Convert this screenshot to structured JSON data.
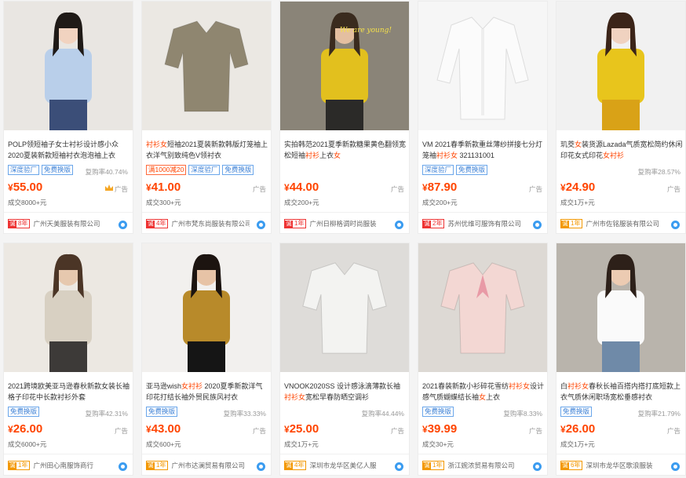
{
  "products": [
    {
      "title": "POLP领短袖子女士衬衫设计感小众2020夏装新款短袖衬衣泡泡袖上衣",
      "title_parts": [
        {
          "t": "POLP领短袖子女士衬衫设计感小众2020夏装新款短袖衬衣泡泡袖上衣",
          "hl": false
        }
      ],
      "tags": [
        {
          "text": "深度验厂",
          "style": "blue"
        },
        {
          "text": "免费换版",
          "style": "blue"
        }
      ],
      "repurchase": "复购率40.74%",
      "price_symbol": "¥",
      "price": "55.00",
      "has_crown": true,
      "ad": "广告",
      "deal": "成交8000+元",
      "years": "8年",
      "badge_color": "red",
      "shop": "广州天美服装有限公司",
      "photo": {
        "bg": "#e9e6e2",
        "top": "#b9cfea",
        "bottom": "#3b4e78",
        "hair": "#1f1a17",
        "skin": "#f1d3c0"
      }
    },
    {
      "title": "衬衫女短袖2021夏装新款韩版灯笼袖上衣洋气别致纯色V领衬衣",
      "title_parts": [
        {
          "t": "衬衫女",
          "hl": true
        },
        {
          "t": "短袖2021夏装新款韩版灯笼袖上衣洋气别致纯色V领衬衣",
          "hl": false
        }
      ],
      "tags": [
        {
          "text": "满1000减20",
          "style": "red"
        },
        {
          "text": "深度验厂",
          "style": "blue"
        },
        {
          "text": "免费换版",
          "style": "blue"
        }
      ],
      "repurchase": "",
      "price_symbol": "¥",
      "price": "41.00",
      "has_crown": false,
      "ad": "广告",
      "deal": "成交300+元",
      "years": "4年",
      "badge_color": "red",
      "shop": "广州市梵东尚服装有限公司",
      "photo": {
        "bg": "#ebe8e3",
        "top": "#8f8670",
        "bottom": "#6c6757",
        "hair": "#d9d5cd",
        "skin": "#ebe8e3"
      }
    },
    {
      "title": "实拍韩范2021夏季新款糖果黄色翻领宽松短袖衬衫上衣女",
      "title_parts": [
        {
          "t": "实拍韩范2021夏季新款糖果黄色翻领宽松短袖",
          "hl": false
        },
        {
          "t": "衬衫",
          "hl": true
        },
        {
          "t": "上衣",
          "hl": false
        },
        {
          "t": "女",
          "hl": true
        }
      ],
      "tags": [],
      "repurchase": "",
      "price_symbol": "¥",
      "price": "44.00",
      "has_crown": false,
      "ad": "广告",
      "deal": "成交200+元",
      "years": "1年",
      "badge_color": "red",
      "shop": "广州日柳格调时尚服装",
      "overlay": "We are young!",
      "photo": {
        "bg": "#8a8478",
        "top": "#e2c01e",
        "bottom": "#2b2a28",
        "hair": "#3a2b1e",
        "skin": "#e4bfa0"
      }
    },
    {
      "title": "VM 2021春季新款重丝薄纱拼接七分灯笼袖衬衫女 321131001",
      "title_parts": [
        {
          "t": "VM 2021春季新款重丝薄纱拼接七分灯笼袖",
          "hl": false
        },
        {
          "t": "衬衫女",
          "hl": true
        },
        {
          "t": " 321131001",
          "hl": false
        }
      ],
      "tags": [
        {
          "text": "深度验厂",
          "style": "blue"
        },
        {
          "text": "免费换版",
          "style": "blue"
        }
      ],
      "repurchase": "",
      "price_symbol": "¥",
      "price": "87.90",
      "has_crown": false,
      "ad": "广告",
      "deal": "成交200+元",
      "years": "2年",
      "badge_color": "red",
      "shop": "苏州优维可服饰有限公司",
      "photo": {
        "bg": "#f6f6f6",
        "top": "#fbfbfb",
        "bottom": "#f6f6f6",
        "hair": "#111111",
        "skin": "#f6f6f6"
      }
    },
    {
      "title": "玑茭女装货源Lazada气质宽松简约休闲印花女式印花女衬衫",
      "title_parts": [
        {
          "t": "玑茭",
          "hl": false
        },
        {
          "t": "女",
          "hl": true
        },
        {
          "t": "装货源Lazada气质宽松简约休闲印花女式印花",
          "hl": false
        },
        {
          "t": "女衬衫",
          "hl": true
        }
      ],
      "tags": [],
      "repurchase": "复购率28.57%",
      "price_symbol": "¥",
      "price": "24.90",
      "has_crown": false,
      "ad": "广告",
      "deal": "成交1万+元",
      "years": "1年",
      "badge_color": "orange",
      "shop": "广州市佐铭服装有限公司",
      "photo": {
        "bg": "#f1f1f1",
        "top": "#e8c51c",
        "bottom": "#d9a217",
        "hair": "#3b2418",
        "skin": "#f0d2c0"
      }
    },
    {
      "title": "2021跨境欧美亚马逊春秋新款女装长袖格子印花中长款衬衫外套",
      "title_parts": [
        {
          "t": "2021跨境欧美亚马逊春秋新款女装长袖格子印花中长款衬衫外套",
          "hl": false
        }
      ],
      "tags": [
        {
          "text": "免费换版",
          "style": "blue"
        }
      ],
      "repurchase": "复购率42.31%",
      "price_symbol": "¥",
      "price": "26.00",
      "has_crown": false,
      "ad": "广告",
      "deal": "成交6000+元",
      "years": "1年",
      "badge_color": "orange",
      "shop": "广州田心南服饰商行",
      "photo": {
        "bg": "#ece8e2",
        "top": "#d8d0c2",
        "bottom": "#3d3a38",
        "hair": "#4b3526",
        "skin": "#e6c8ae"
      }
    },
    {
      "title": "亚马逊wish女衬衫 2020夏季新款洋气印花打结长袖外贸民族风衬衣",
      "title_parts": [
        {
          "t": "亚马逊wish",
          "hl": false
        },
        {
          "t": "女衬衫",
          "hl": true
        },
        {
          "t": " 2020夏季新款洋气印花打结长袖外贸民族风衬衣",
          "hl": false
        }
      ],
      "tags": [
        {
          "text": "免费换版",
          "style": "blue"
        }
      ],
      "repurchase": "复购率33.33%",
      "price_symbol": "¥",
      "price": "43.00",
      "has_crown": false,
      "ad": "广告",
      "deal": "成交600+元",
      "years": "1年",
      "badge_color": "orange",
      "shop": "广州市达澜贸易有限公司",
      "photo": {
        "bg": "#f2f0ee",
        "top": "#b88a2a",
        "bottom": "#151515",
        "hair": "#1c1410",
        "skin": "#e7c3a6"
      }
    },
    {
      "title": "VNOOK2020SS 设计感泳滴薄款长袖衬衫女宽松早春防晒空调衫",
      "title_parts": [
        {
          "t": "VNOOK2020SS 设计感泳滴薄款长袖",
          "hl": false
        },
        {
          "t": "衬衫女",
          "hl": true
        },
        {
          "t": "宽松早春防晒空调衫",
          "hl": false
        }
      ],
      "tags": [],
      "repurchase": "复购率44.44%",
      "price_symbol": "¥",
      "price": "25.00",
      "has_crown": false,
      "ad": "广告",
      "deal": "成交1万+元",
      "years": "4年",
      "badge_color": "orange",
      "shop": "深圳市龙华区美亿人服",
      "photo": {
        "bg": "#dedcd9",
        "top": "#f3f3f1",
        "bottom": "#cfcdca",
        "hair": "#dedcd9",
        "skin": "#dedcd9"
      }
    },
    {
      "title": "2021春装新款小衫碎花雪纺衬衫女设计感气质蝴蝶结长袖女上衣",
      "title_parts": [
        {
          "t": "2021春装新款小衫碎花雪纺",
          "hl": false
        },
        {
          "t": "衬衫女",
          "hl": true
        },
        {
          "t": "设计感气质蝴蝶结长袖",
          "hl": false
        },
        {
          "t": "女",
          "hl": true
        },
        {
          "t": "上衣",
          "hl": false
        }
      ],
      "tags": [
        {
          "text": "免费换版",
          "style": "blue"
        }
      ],
      "repurchase": "复购率8.33%",
      "price_symbol": "¥",
      "price": "39.99",
      "has_crown": false,
      "ad": "广告",
      "deal": "成交30+元",
      "years": "1年",
      "badge_color": "orange",
      "shop": "浙江婉浓贸易有限公司",
      "photo": {
        "bg": "#ddd9d4",
        "top": "#f3d7d3",
        "bottom": "#e8e2d4",
        "hair": "#ddd9d4",
        "skin": "#ddd9d4"
      }
    },
    {
      "title": "白衬衫女春秋长袖百搭内搭打底短款上衣气质休闲职场宽松垂感衬衣",
      "title_parts": [
        {
          "t": "白",
          "hl": false
        },
        {
          "t": "衬衫女",
          "hl": true
        },
        {
          "t": "春秋长袖百搭内搭打底短款上衣气质休闲职场宽松垂感衬衣",
          "hl": false
        }
      ],
      "tags": [
        {
          "text": "免费换版",
          "style": "blue"
        }
      ],
      "repurchase": "复购率21.79%",
      "price_symbol": "¥",
      "price": "26.00",
      "has_crown": false,
      "ad": "广告",
      "deal": "成交1万+元",
      "years": "6年",
      "badge_color": "orange",
      "shop": "深圳市龙华区歌浪服装",
      "photo": {
        "bg": "#b9b4ac",
        "top": "#fafafa",
        "bottom": "#6f8aa8",
        "hair": "#2d2019",
        "skin": "#eccbb2"
      }
    }
  ]
}
